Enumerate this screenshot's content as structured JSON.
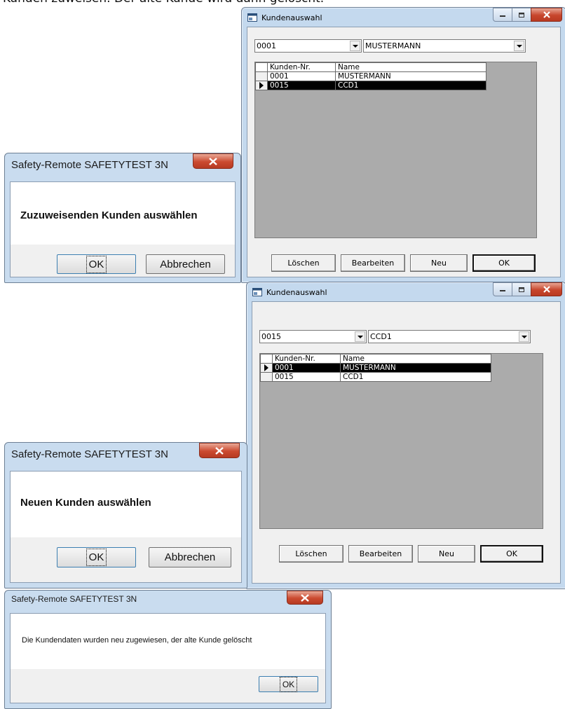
{
  "heading": "Kunden zuweisen. Der alte Kunde wird dann gelöscht.",
  "window_a": {
    "title": "Kundenauswahl",
    "combo_number": "0001",
    "combo_name": "MUSTERMANN",
    "grid_headers": [
      "Kunden-Nr.",
      "Name"
    ],
    "rows": [
      {
        "number": "0001",
        "name": "MUSTERMANN",
        "selected": false
      },
      {
        "number": "0015",
        "name": "CCD1",
        "selected": true
      }
    ],
    "buttons": {
      "delete": "Löschen",
      "edit": "Bearbeiten",
      "new": "Neu",
      "ok": "OK"
    }
  },
  "window_b": {
    "title": "Kundenauswahl",
    "combo_number": "0015",
    "combo_name": "CCD1",
    "grid_headers": [
      "Kunden-Nr.",
      "Name"
    ],
    "rows": [
      {
        "number": "0001",
        "name": "MUSTERMANN",
        "selected": true
      },
      {
        "number": "0015",
        "name": "CCD1",
        "selected": false
      }
    ],
    "buttons": {
      "delete": "Löschen",
      "edit": "Bearbeiten",
      "new": "Neu",
      "ok": "OK"
    }
  },
  "dialog_1": {
    "title": "Safety-Remote SAFETYTEST 3N",
    "message": "Zuzuweisenden Kunden auswählen",
    "ok": "OK",
    "cancel": "Abbrechen"
  },
  "dialog_2": {
    "title": "Safety-Remote SAFETYTEST 3N",
    "message": "Neuen Kunden auswählen",
    "ok": "OK",
    "cancel": "Abbrechen"
  },
  "dialog_3": {
    "title": "Safety-Remote SAFETYTEST 3N",
    "message": "Die Kundendaten wurden neu zugewiesen, der alte Kunde gelöscht",
    "ok": "OK"
  }
}
